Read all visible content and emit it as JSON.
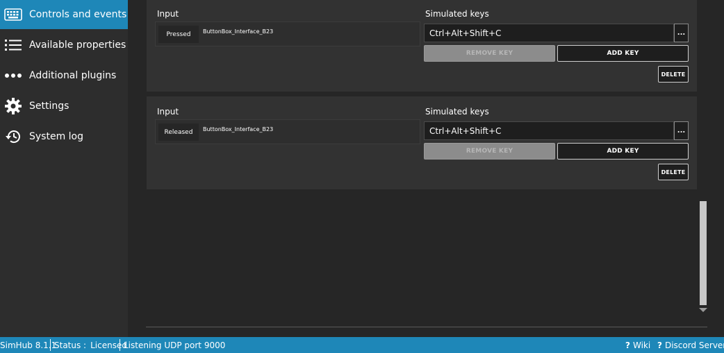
{
  "sidebar": {
    "items": [
      {
        "label": "Controls and events",
        "icon": "keyboard-icon",
        "active": true
      },
      {
        "label": "Available properties",
        "icon": "list-icon",
        "active": false
      },
      {
        "label": "Additional plugins",
        "icon": "more-dots-icon",
        "active": false
      },
      {
        "label": "Settings",
        "icon": "gear-icon",
        "active": false
      },
      {
        "label": "System log",
        "icon": "history-icon",
        "active": false
      }
    ]
  },
  "mappings": [
    {
      "input_label": "Input",
      "keys_label": "Simulated keys",
      "state": "Pressed",
      "control": "ButtonBox_Interface_B23",
      "keys": "Ctrl+Alt+Shift+C",
      "browse_label": "...",
      "remove_label": "REMOVE KEY",
      "add_label": "ADD KEY",
      "delete_label": "DELETE"
    },
    {
      "input_label": "Input",
      "keys_label": "Simulated keys",
      "state": "Released",
      "control": "ButtonBox_Interface_B23",
      "keys": "Ctrl+Alt+Shift+C",
      "browse_label": "...",
      "remove_label": "REMOVE KEY",
      "add_label": "ADD KEY",
      "delete_label": "DELETE"
    }
  ],
  "statusbar": {
    "app_version": "SimHub 8.1.1",
    "status_label": "Status :",
    "status_value": "Licensed",
    "listening": "Listening UDP port 9000",
    "wiki": "Wiki",
    "discord": "Discord Server",
    "help_glyph": "?"
  },
  "colors": {
    "accent": "#1e87b8",
    "sidebar_bg": "#2d2d2d",
    "main_bg": "#262626",
    "panel_bg": "#323232"
  }
}
